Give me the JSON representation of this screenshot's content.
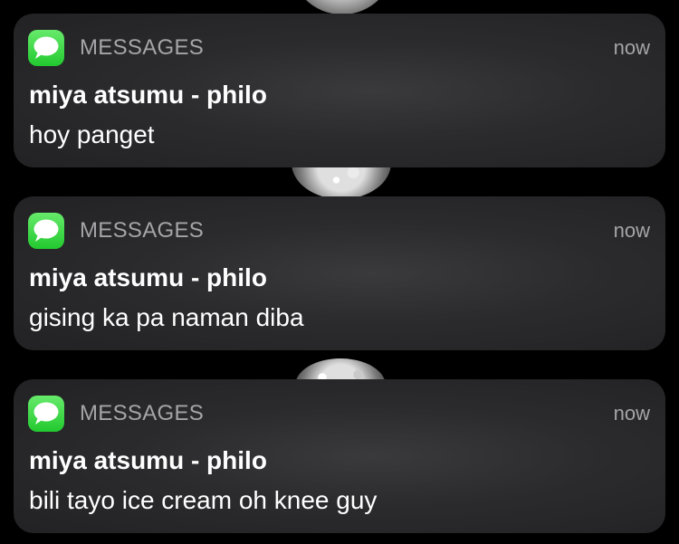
{
  "notifications": [
    {
      "app_name": "MESSAGES",
      "time": "now",
      "icon": "messages-icon",
      "sender": "miya atsumu - philo",
      "message": "hoy panget"
    },
    {
      "app_name": "MESSAGES",
      "time": "now",
      "icon": "messages-icon",
      "sender": "miya atsumu - philo",
      "message": "gising ka pa naman diba"
    },
    {
      "app_name": "MESSAGES",
      "time": "now",
      "icon": "messages-icon",
      "sender": "miya atsumu - philo",
      "message": "bili tayo ice cream oh knee guy"
    }
  ],
  "colors": {
    "background": "#000000",
    "card": "#2b2b2d",
    "icon_green": "#2fd13a",
    "secondary_text": "#a5a5a9",
    "primary_text": "#ffffff"
  }
}
